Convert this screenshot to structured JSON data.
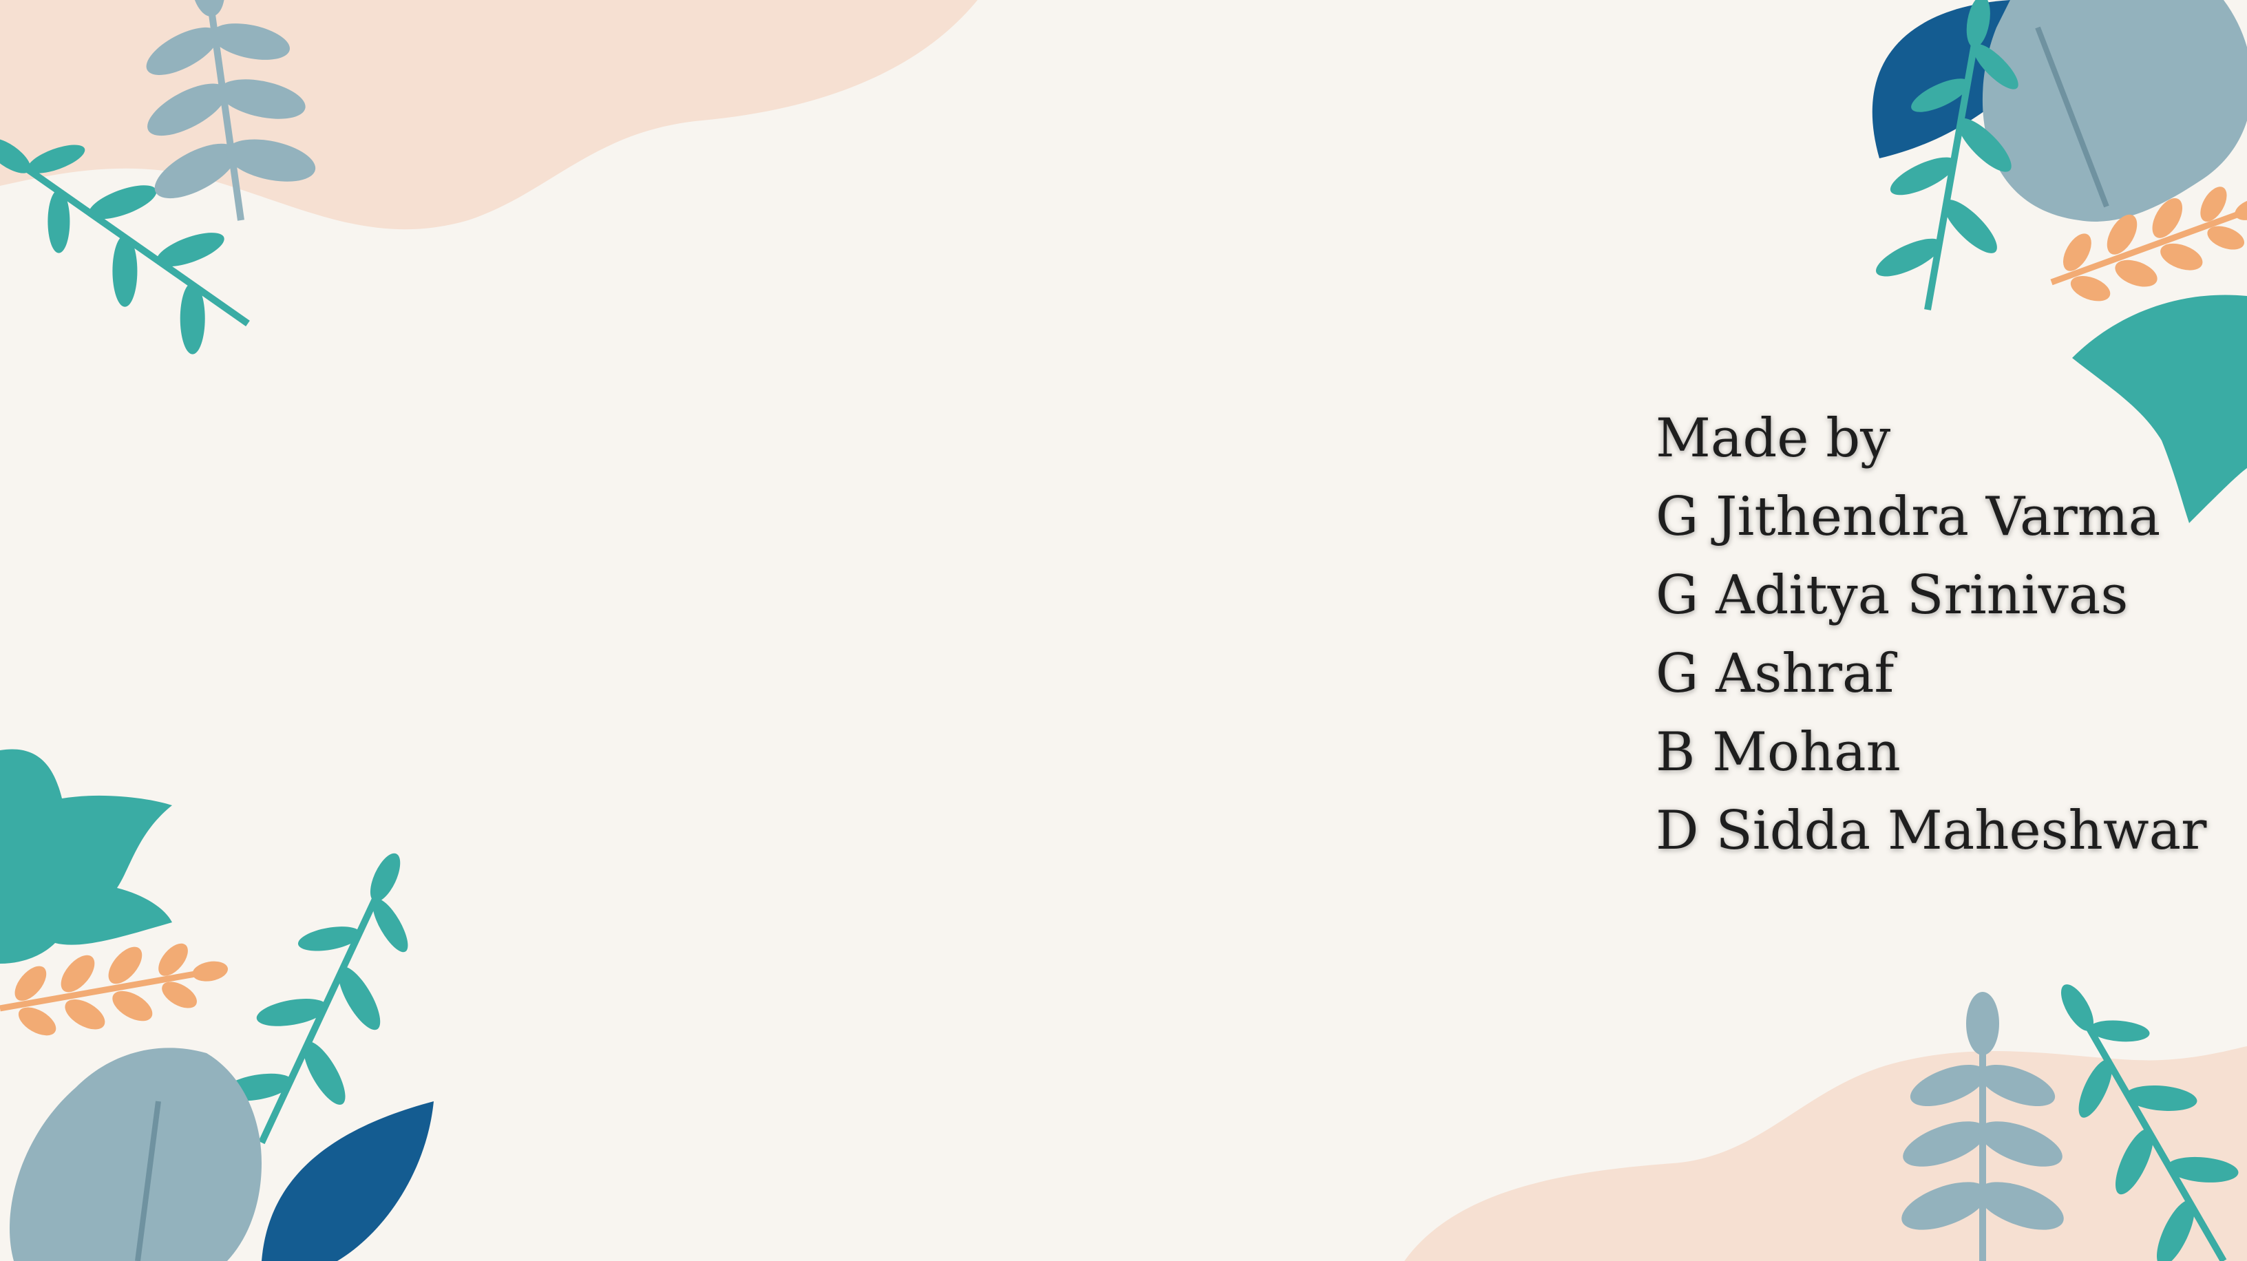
{
  "slide": {
    "heading": "Made by",
    "members": [
      "G Jithendra Varma",
      "G Aditya Srinivas",
      "G Ashraf",
      "B Mohan",
      "D Sidda Maheshwar"
    ]
  },
  "colors": {
    "background": "#f8f5f0",
    "peach_blob": "#f6e0d2",
    "teal_leaf": "#3aaca4",
    "grey_blue_leaf": "#93b2bd",
    "dark_blue_leaf": "#145c91",
    "orange_sprig": "#f2ab74",
    "text": "#1e1e1e"
  }
}
